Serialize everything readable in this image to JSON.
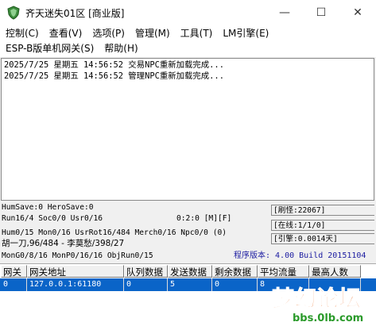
{
  "window": {
    "title": "齐天迷失01区 [商业版]",
    "minimize": "—",
    "maximize": "☐",
    "close": "✕",
    "icon": "green-shield-icon"
  },
  "menu": {
    "row1": [
      "控制(C)",
      "查看(V)",
      "选项(P)",
      "管理(M)",
      "工具(T)",
      "LM引擎(E)"
    ],
    "row2": [
      "ESP-B版单机网关(S)",
      "帮助(H)"
    ]
  },
  "log": [
    "2025/7/25 星期五 14:56:52 交易NPC重新加载完成...",
    "2025/7/25 星期五 14:56:52 管理NPC重新加载完成..."
  ],
  "status": {
    "line1": "HumSave:0 HeroSave:0",
    "line2": "Run16/4 Soc0/0 Usr0/16",
    "time": "0:2:0 [M][F]",
    "line3": "Hum0/15 Mon0/16 UsrRot16/484 Merch0/16 Npc0/0 (0)",
    "line4": "胡一刀,96/484 - 李莫愁/398/27",
    "line5": "MonG0/8/16 MonP0/16/16 ObjRun0/15",
    "counters": [
      "[刷怪:22067]",
      "[在线:1/1/0]",
      "[引擎:0.0014天]"
    ],
    "version": "程序版本: 4.00 Build 20151104"
  },
  "grid": {
    "headers": [
      "网关",
      "网关地址",
      "队列数据",
      "发送数据",
      "剩余数据",
      "平均流量",
      "最高人数"
    ],
    "rows": [
      [
        "0",
        "127.0.0.1:61180",
        "0",
        "5",
        "0",
        "8",
        ""
      ]
    ]
  },
  "watermark": {
    "text": "梦幻论坛",
    "url": "bbs.0lb.com"
  },
  "colors": {
    "selection": "#0a64c8",
    "version_text": "#1a1aa0",
    "watermark_orange": "#e8661a",
    "watermark_green": "#2a9a2a"
  }
}
